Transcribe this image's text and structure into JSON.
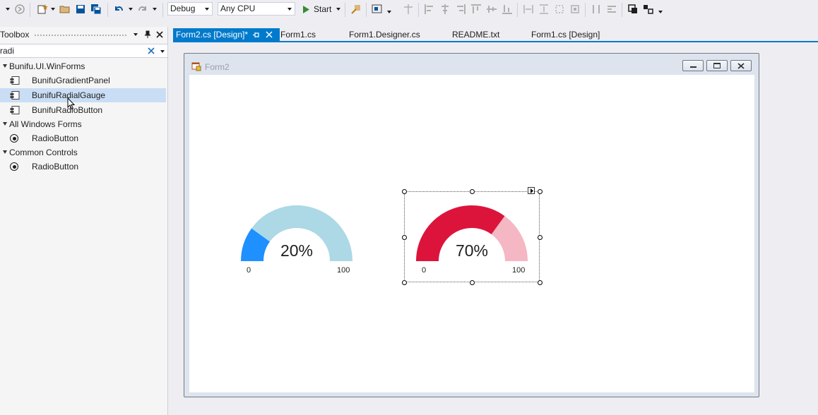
{
  "toolbar": {
    "configuration": "Debug",
    "platform": "Any CPU",
    "start_label": "Start"
  },
  "toolbox": {
    "title": "Toolbox",
    "search_value": "radi",
    "groups": [
      {
        "label": "Bunifu.UI.WinForms",
        "items": [
          "BunifuGradientPanel",
          "BunifuRadialGauge",
          "BunifuRadioButton"
        ]
      },
      {
        "label": "All Windows Forms",
        "items": [
          "RadioButton"
        ]
      },
      {
        "label": "Common Controls",
        "items": [
          "RadioButton"
        ]
      }
    ]
  },
  "tabs": [
    {
      "label": "Form2.cs [Design]*"
    },
    {
      "label": "Form1.cs"
    },
    {
      "label": "Form1.Designer.cs"
    },
    {
      "label": "README.txt"
    },
    {
      "label": "Form1.cs [Design]"
    }
  ],
  "form": {
    "title": "Form2"
  },
  "gauges": [
    {
      "value": 20,
      "value_label": "20%",
      "min_label": "0",
      "max_label": "100",
      "progress_color": "#1e90ff",
      "track_color": "#add8e6"
    },
    {
      "value": 70,
      "value_label": "70%",
      "min_label": "0",
      "max_label": "100",
      "progress_color": "#dc143c",
      "track_color": "#f4b7c3"
    }
  ]
}
